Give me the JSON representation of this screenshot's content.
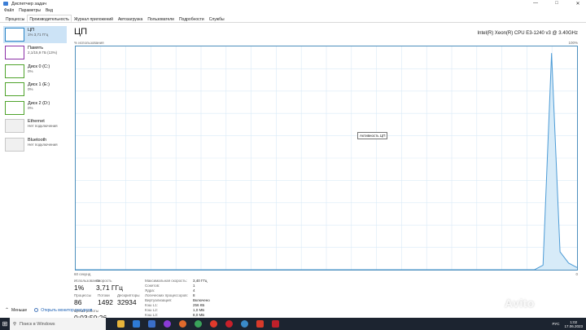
{
  "window": {
    "title": "Диспетчер задач",
    "controls": [
      "—",
      "□",
      "✕"
    ]
  },
  "menu": [
    "Файл",
    "Параметры",
    "Вид"
  ],
  "tabs": [
    "Процессы",
    "Производительность",
    "Журнал приложений",
    "Автозагрузка",
    "Пользователи",
    "Подробности",
    "Службы"
  ],
  "sidebar": [
    {
      "name": "ЦП",
      "value": "1% 3,71 ГГц",
      "color": "#2a84c6"
    },
    {
      "name": "Память",
      "value": "2,1/15,9 ГБ (13%)",
      "color": "#8b2fa6"
    },
    {
      "name": "Диск 0 (C:)",
      "value": "0%",
      "color": "#4fa32b"
    },
    {
      "name": "Диск 1 (E:)",
      "value": "0%",
      "color": "#4fa32b"
    },
    {
      "name": "Диск 2 (D:)",
      "value": "0%",
      "color": "#4fa32b"
    },
    {
      "name": "Ethernet",
      "value": "Нет подключения",
      "color": "#c8c8c8"
    },
    {
      "name": "Bluetooth",
      "value": "Нет подключения",
      "color": "#c8c8c8"
    }
  ],
  "main": {
    "heading": "ЦП",
    "cpu_model": "Intel(R) Xeon(R) CPU E3-1240 v3 @ 3.40GHz",
    "util_axis_label": "% использования",
    "max_label": "100%",
    "time_label": "60 секунд",
    "zero_label": "0",
    "tooltip": "Активность ЦП"
  },
  "stats": {
    "usage": {
      "label": "Использование",
      "value": "1%"
    },
    "speed": {
      "label": "Скорость",
      "value": "3,71 ГГц"
    },
    "processes": {
      "label": "Процессы",
      "value": "86"
    },
    "threads": {
      "label": "Потоки",
      "value": "1492"
    },
    "handles": {
      "label": "Дескрипторы",
      "value": "32934"
    },
    "uptime": {
      "label": "Время работы",
      "value": "0:03:50:26"
    }
  },
  "specs": [
    {
      "k": "Максимальная скорость:",
      "v": "3,40 ГГц"
    },
    {
      "k": "Сокетов:",
      "v": "1"
    },
    {
      "k": "Ядра:",
      "v": "4"
    },
    {
      "k": "Логических процессоров:",
      "v": "8"
    },
    {
      "k": "Виртуализация:",
      "v": "Включено"
    },
    {
      "k": "Кэш L1:",
      "v": "256 КБ"
    },
    {
      "k": "Кэш L2:",
      "v": "1,0 МБ"
    },
    {
      "k": "Кэш L3:",
      "v": "8,0 МБ"
    }
  ],
  "footer": {
    "less": "Меньше",
    "monitor_link": "Открыть монитор ресурсов"
  },
  "taskbar": {
    "search_placeholder": "Поиск в Windows",
    "lang": "РУС",
    "time": "1:02",
    "date": "17.06.2023",
    "icons": [
      "folder-icon",
      "edge-icon",
      "store-icon",
      "alice-icon",
      "firefox-icon",
      "chrome-icon",
      "yandex-icon",
      "opera-icon",
      "vpn-icon",
      "mail-icon",
      "app64-icon"
    ]
  },
  "watermark": "Avito",
  "chart_data": {
    "type": "area",
    "x_range": [
      60,
      0
    ],
    "ylim": [
      0,
      100
    ],
    "series": [
      {
        "values": [
          0,
          0,
          0,
          0,
          0,
          0,
          0,
          0,
          0,
          0,
          0,
          0,
          0,
          0,
          0,
          0,
          0,
          0,
          0,
          0,
          0,
          0,
          0,
          0,
          0,
          0,
          0,
          0,
          0,
          0,
          0,
          0,
          0,
          0,
          0,
          0,
          0,
          0,
          0,
          0,
          0,
          0,
          0,
          0,
          0,
          0,
          0,
          0,
          0,
          0,
          0,
          0,
          0,
          0,
          0,
          2,
          97,
          8,
          3,
          1
        ]
      }
    ]
  }
}
